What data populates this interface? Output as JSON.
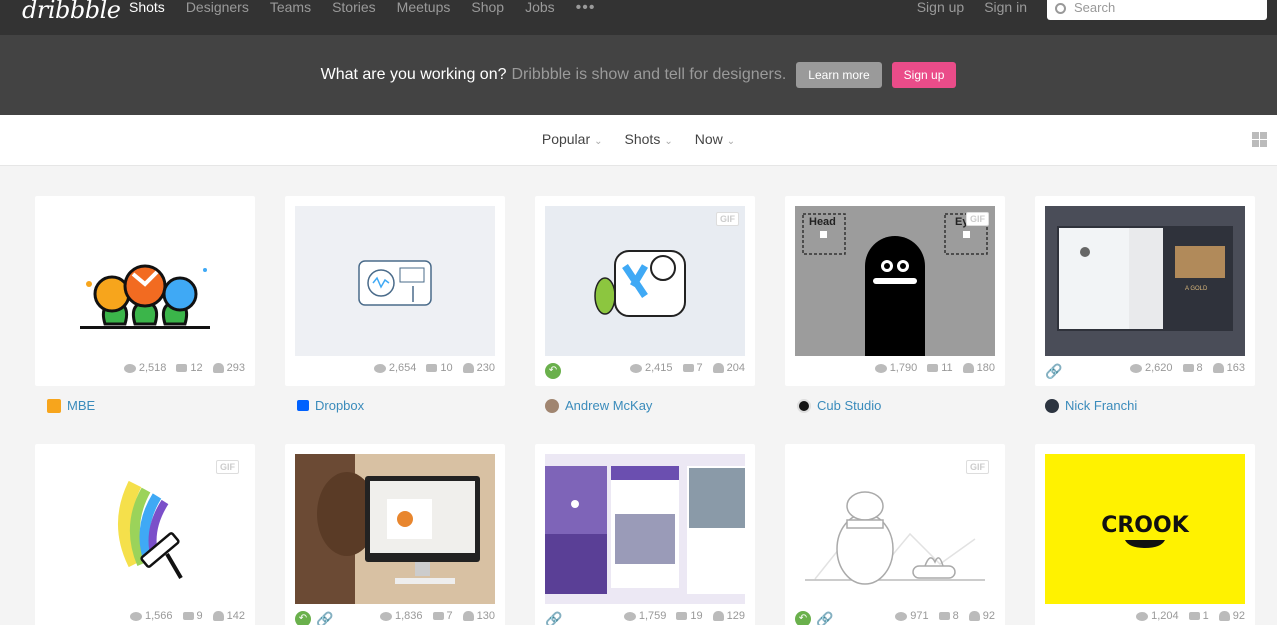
{
  "nav": {
    "logo": "dribbble",
    "links": [
      "Shots",
      "Designers",
      "Teams",
      "Stories",
      "Meetups",
      "Shop",
      "Jobs"
    ],
    "more": "•••",
    "signup": "Sign up",
    "signin": "Sign in",
    "search_placeholder": "Search"
  },
  "banner": {
    "question": "What are you working on?",
    "tagline": "Dribbble is show and tell for designers.",
    "learn_more": "Learn more",
    "signup": "Sign up"
  },
  "filters": {
    "sort": "Popular",
    "type": "Shots",
    "time": "Now"
  },
  "shots": [
    {
      "views": "2,518",
      "comments": "12",
      "likes": "293",
      "owner": "MBE",
      "gif": false
    },
    {
      "views": "2,654",
      "comments": "10",
      "likes": "230",
      "owner": "Dropbox",
      "gif": false
    },
    {
      "views": "2,415",
      "comments": "7",
      "likes": "204",
      "owner": "Andrew McKay",
      "gif": true
    },
    {
      "views": "1,790",
      "comments": "11",
      "likes": "180",
      "owner": "Cub Studio",
      "gif": true
    },
    {
      "views": "2,620",
      "comments": "8",
      "likes": "163",
      "owner": "Nick Franchi",
      "gif": false
    },
    {
      "views": "1,566",
      "comments": "9",
      "likes": "142",
      "gif": true
    },
    {
      "views": "1,836",
      "comments": "7",
      "likes": "130",
      "gif": false
    },
    {
      "views": "1,759",
      "comments": "19",
      "likes": "129",
      "gif": false
    },
    {
      "views": "971",
      "comments": "8",
      "likes": "92",
      "gif": true
    },
    {
      "views": "1,204",
      "comments": "1",
      "likes": "92",
      "gif": false
    }
  ],
  "art_text": {
    "head": "Head",
    "eye": "Ey",
    "crook": "CROOK",
    "gif_label": "GIF",
    "gold": "A GOLD"
  },
  "colors": {
    "brand_pink": "#ea4c89",
    "link_blue": "#3a8bbb",
    "nav_bg": "#333333",
    "banner_bg": "#434343"
  }
}
